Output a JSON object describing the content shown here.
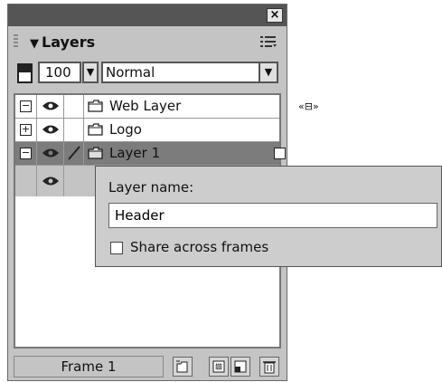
{
  "panel": {
    "close_glyph": "×",
    "title": "Layers",
    "collapse_glyph": "▼",
    "options_icon": "panel-options-icon"
  },
  "toolbar": {
    "opacity_value": "100",
    "blend_mode": "Normal"
  },
  "layers": [
    {
      "name": "Web Layer",
      "expand_glyph": "−",
      "visible": true,
      "shared_glyph": "«⊟»"
    },
    {
      "name": "Logo",
      "expand_glyph": "+",
      "visible": true
    },
    {
      "name": "Layer 1",
      "expand_glyph": "−",
      "visible": true,
      "selected": true
    }
  ],
  "footer": {
    "frame_label": "Frame 1"
  },
  "popup": {
    "label": "Layer name:",
    "value": "Header",
    "share_label": "Share across frames",
    "share_checked": false
  }
}
